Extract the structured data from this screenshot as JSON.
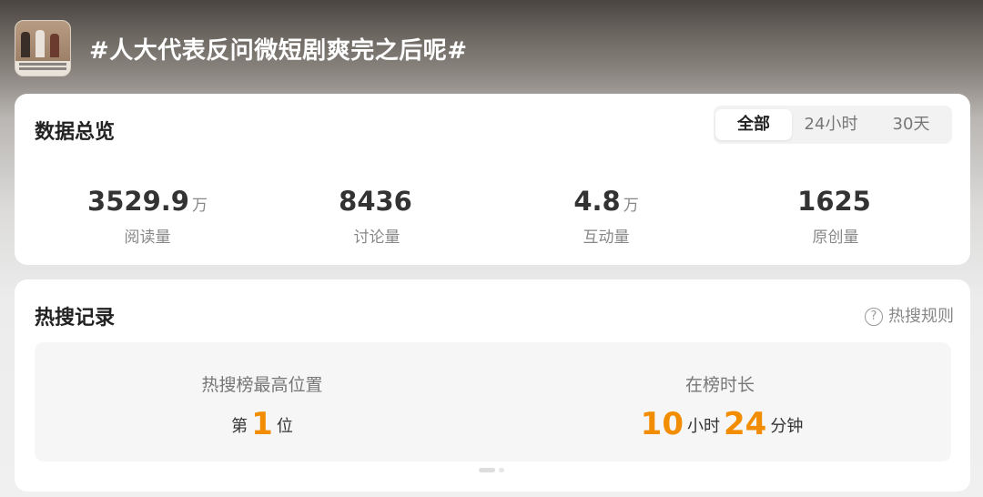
{
  "header": {
    "title": "#人大代表反问微短剧爽完之后呢#"
  },
  "overview": {
    "title": "数据总览",
    "tabs": [
      {
        "label": "全部",
        "active": true
      },
      {
        "label": "24小时",
        "active": false
      },
      {
        "label": "30天",
        "active": false
      }
    ],
    "stats": [
      {
        "value": "3529.9",
        "unit": "万",
        "label": "阅读量"
      },
      {
        "value": "8436",
        "unit": "",
        "label": "讨论量"
      },
      {
        "value": "4.8",
        "unit": "万",
        "label": "互动量"
      },
      {
        "value": "1625",
        "unit": "",
        "label": "原创量"
      }
    ]
  },
  "record": {
    "title": "热搜记录",
    "rules_label": "热搜规则",
    "rules_icon": "question-circle-icon",
    "peak": {
      "label": "热搜榜最高位置",
      "prefix": "第",
      "rank": "1",
      "suffix": "位"
    },
    "duration": {
      "label": "在榜时长",
      "hours": "10",
      "hours_unit": "小时",
      "minutes": "24",
      "minutes_unit": "分钟"
    }
  },
  "colors": {
    "accent": "#f28c00",
    "card": "#ffffff",
    "title": "#ffffff"
  }
}
